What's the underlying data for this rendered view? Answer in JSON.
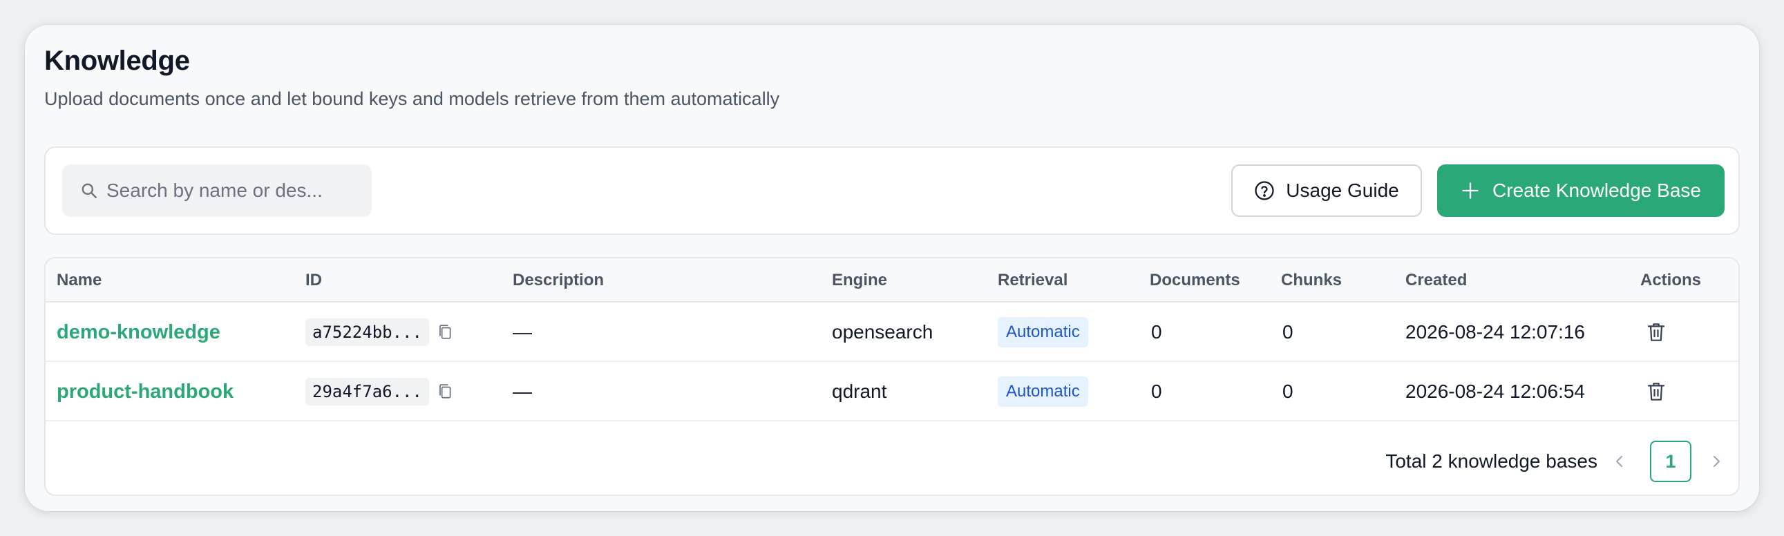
{
  "header": {
    "title": "Knowledge",
    "subtitle": "Upload documents once and let bound keys and models retrieve from them automatically"
  },
  "toolbar": {
    "search_placeholder": "Search by name or des...",
    "search_icon": "search-icon",
    "guide_label": "Usage Guide",
    "guide_icon": "question-circle-icon",
    "create_label": "Create Knowledge Base",
    "create_icon": "plus-icon"
  },
  "table": {
    "columns": [
      "Name",
      "ID",
      "Description",
      "Engine",
      "Retrieval",
      "Documents",
      "Chunks",
      "Created",
      "Actions"
    ],
    "rows": [
      {
        "name": "demo-knowledge",
        "id": "a75224bb...",
        "description": "—",
        "engine": "opensearch",
        "retrieval": "Automatic",
        "documents": "0",
        "chunks": "0",
        "created": "2026-08-24 12:07:16"
      },
      {
        "name": "product-handbook",
        "id": "29a4f7a6...",
        "description": "—",
        "engine": "qdrant",
        "retrieval": "Automatic",
        "documents": "0",
        "chunks": "0",
        "created": "2026-08-24 12:06:54"
      }
    ]
  },
  "pagination": {
    "total_text": "Total 2 knowledge bases",
    "current_page": "1"
  },
  "colors": {
    "accent": "#2ba878",
    "badge_bg": "#e6f2fd",
    "badge_text": "#1d56c9"
  }
}
